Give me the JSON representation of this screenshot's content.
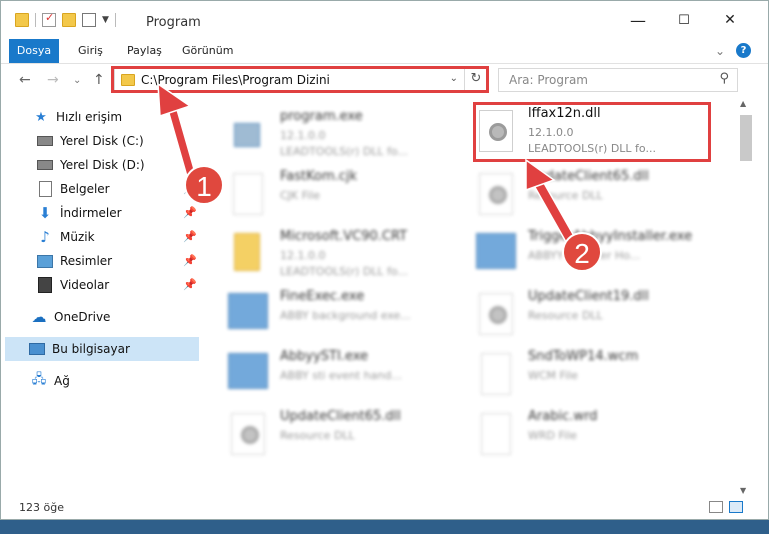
{
  "window": {
    "title": "Program",
    "controls": {
      "minimize": "—",
      "maximize": "☐",
      "close": "✕"
    }
  },
  "ribbon": {
    "tabs": [
      "Dosya",
      "Giriş",
      "Paylaş",
      "Görünüm"
    ],
    "expand": "⌄",
    "help": "?"
  },
  "navigation": {
    "back": "←",
    "forward": "→",
    "recent": "⌄",
    "up": "↑",
    "address": "C:\\Program Files\\Program Dizini",
    "search_placeholder": "Ara: Program"
  },
  "sidebar": {
    "items": [
      {
        "label": "Hızlı erişim",
        "icon": "star-icon",
        "pinned": false
      },
      {
        "label": "Yerel Disk (C:)",
        "icon": "drive-icon",
        "pinned": true
      },
      {
        "label": "Yerel Disk (D:)",
        "icon": "drive-icon",
        "pinned": true
      },
      {
        "label": "Belgeler",
        "icon": "documents-icon",
        "pinned": true
      },
      {
        "label": "İndirmeler",
        "icon": "download-icon",
        "pinned": true
      },
      {
        "label": "Müzik",
        "icon": "music-icon",
        "pinned": true
      },
      {
        "label": "Resimler",
        "icon": "pictures-icon",
        "pinned": true
      },
      {
        "label": "Videolar",
        "icon": "video-icon",
        "pinned": true
      },
      {
        "label": "OneDrive",
        "icon": "cloud-icon",
        "pinned": false
      },
      {
        "label": "Bu bilgisayar",
        "icon": "computer-icon",
        "pinned": false
      },
      {
        "label": "Ağ",
        "icon": "network-icon",
        "pinned": false
      }
    ]
  },
  "files": [
    {
      "name": "program.exe",
      "line2": "12.1.0.0",
      "line3": "LEADTOOLS(r) DLL fo...",
      "icon": "exe-icon"
    },
    {
      "name": "lffax12n.dll",
      "line2": "12.1.0.0",
      "line3": "LEADTOOLS(r) DLL fo...",
      "icon": "dll-gear-icon"
    },
    {
      "name": "FastKom.cjk",
      "line2": "CJK File",
      "line3": "",
      "icon": "blank-file-icon"
    },
    {
      "name": "UpdateClient65.dll",
      "line2": "Resource DLL",
      "line3": "",
      "icon": "dll-gear-icon"
    },
    {
      "name": "Microsoft.VC90.CRT",
      "line2": "12.1.0.0",
      "line3": "LEADTOOLS(r) DLL fo...",
      "icon": "folder-icon"
    },
    {
      "name": "TriggerAbbyyInstaller.exe",
      "line2": "ABBYY Installer Ho...",
      "line3": "",
      "icon": "app-icon"
    },
    {
      "name": "FineExec.exe",
      "line2": "ABBY background exe...",
      "line3": "",
      "icon": "app-icon"
    },
    {
      "name": "UpdateClient19.dll",
      "line2": "Resource DLL",
      "line3": "",
      "icon": "dll-gear-icon"
    },
    {
      "name": "AbbyySTI.exe",
      "line2": "ABBY sti event hand...",
      "line3": "",
      "icon": "app-icon"
    },
    {
      "name": "SndToWP14.wcm",
      "line2": "WCM File",
      "line3": "",
      "icon": "blank-file-icon"
    },
    {
      "name": "UpdateClient65.dll",
      "line2": "Resource DLL",
      "line3": "",
      "icon": "dll-gear-icon"
    },
    {
      "name": "Arabic.wrd",
      "line2": "WRD File",
      "line3": "",
      "icon": "blank-file-icon"
    }
  ],
  "status": {
    "count": "123 öğe"
  },
  "annotations": {
    "step1": "1",
    "step2": "2"
  },
  "colors": {
    "accent": "#1979ca",
    "annotation": "#e04040"
  }
}
